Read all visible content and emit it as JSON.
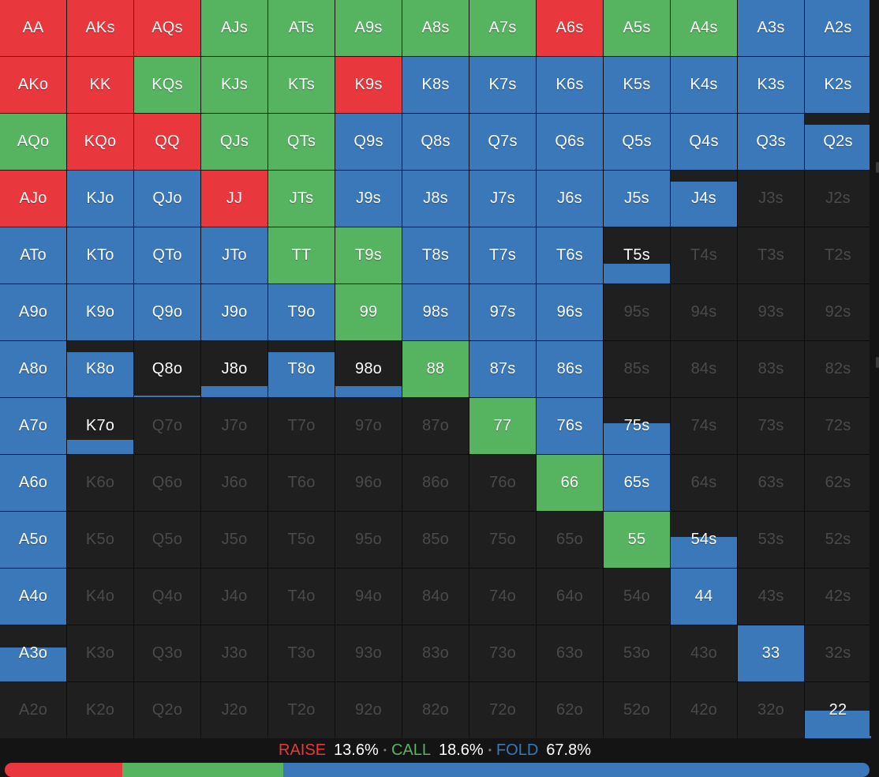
{
  "colors": {
    "raise": "#e8383d",
    "call": "#56b360",
    "fold": "#3a78ba",
    "empty": "#1f1f1f"
  },
  "summary": {
    "raise_label": "RAISE",
    "raise_pct": "13.6%",
    "call_label": "CALL",
    "call_pct": "18.6%",
    "fold_label": "FOLD",
    "fold_pct": "67.8%"
  },
  "bar": {
    "raise": 0.136,
    "call": 0.186,
    "fold": 0.678
  },
  "cells": [
    [
      "AA",
      "r"
    ],
    [
      "AKs",
      "r"
    ],
    [
      "AQs",
      "r"
    ],
    [
      "AJs",
      "c"
    ],
    [
      "ATs",
      "c"
    ],
    [
      "A9s",
      "c"
    ],
    [
      "A8s",
      "c"
    ],
    [
      "A7s",
      "c"
    ],
    [
      "A6s",
      "r"
    ],
    [
      "A5s",
      "c"
    ],
    [
      "A4s",
      "c"
    ],
    [
      "A3s",
      "f"
    ],
    [
      "A2s",
      "f"
    ],
    [
      "AKo",
      "r"
    ],
    [
      "KK",
      "r"
    ],
    [
      "KQs",
      "c"
    ],
    [
      "KJs",
      "c"
    ],
    [
      "KTs",
      "c"
    ],
    [
      "K9s",
      "r"
    ],
    [
      "K8s",
      "f"
    ],
    [
      "K7s",
      "f"
    ],
    [
      "K6s",
      "f"
    ],
    [
      "K5s",
      "f"
    ],
    [
      "K4s",
      "f"
    ],
    [
      "K3s",
      "f"
    ],
    [
      "K2s",
      "f"
    ],
    [
      "AQo",
      "c"
    ],
    [
      "KQo",
      "r"
    ],
    [
      "QQ",
      "r"
    ],
    [
      "QJs",
      "c"
    ],
    [
      "QTs",
      "c"
    ],
    [
      "Q9s",
      "f"
    ],
    [
      "Q8s",
      "f"
    ],
    [
      "Q7s",
      "f"
    ],
    [
      "Q6s",
      "f"
    ],
    [
      "Q5s",
      "f"
    ],
    [
      "Q4s",
      "f"
    ],
    [
      "Q3s",
      "f"
    ],
    [
      "Q2s",
      "f",
      0.8
    ],
    [
      "AJo",
      "r"
    ],
    [
      "KJo",
      "f"
    ],
    [
      "QJo",
      "f"
    ],
    [
      "JJ",
      "r"
    ],
    [
      "JTs",
      "c"
    ],
    [
      "J9s",
      "f"
    ],
    [
      "J8s",
      "f"
    ],
    [
      "J7s",
      "f"
    ],
    [
      "J6s",
      "f"
    ],
    [
      "J5s",
      "f"
    ],
    [
      "J4s",
      "f",
      0.8
    ],
    [
      "J3s",
      ""
    ],
    [
      "J2s",
      ""
    ],
    [
      "ATo",
      "f"
    ],
    [
      "KTo",
      "f"
    ],
    [
      "QTo",
      "f"
    ],
    [
      "JTo",
      "f"
    ],
    [
      "TT",
      "c"
    ],
    [
      "T9s",
      "c"
    ],
    [
      "T8s",
      "f"
    ],
    [
      "T7s",
      "f"
    ],
    [
      "T6s",
      "f"
    ],
    [
      "T5s",
      "f",
      0.35
    ],
    [
      "T4s",
      ""
    ],
    [
      "T3s",
      ""
    ],
    [
      "T2s",
      ""
    ],
    [
      "A9o",
      "f"
    ],
    [
      "K9o",
      "f"
    ],
    [
      "Q9o",
      "f"
    ],
    [
      "J9o",
      "f"
    ],
    [
      "T9o",
      "f"
    ],
    [
      "99",
      "c"
    ],
    [
      "98s",
      "f"
    ],
    [
      "97s",
      "f"
    ],
    [
      "96s",
      "f"
    ],
    [
      "95s",
      ""
    ],
    [
      "94s",
      ""
    ],
    [
      "93s",
      ""
    ],
    [
      "92s",
      ""
    ],
    [
      "A8o",
      "f"
    ],
    [
      "K8o",
      "f",
      0.8
    ],
    [
      "Q8o",
      "f",
      0.03
    ],
    [
      "J8o",
      "f",
      0.2
    ],
    [
      "T8o",
      "f",
      0.8
    ],
    [
      "98o",
      "f",
      0.2
    ],
    [
      "88",
      "c"
    ],
    [
      "87s",
      "f"
    ],
    [
      "86s",
      "f"
    ],
    [
      "85s",
      ""
    ],
    [
      "84s",
      ""
    ],
    [
      "83s",
      ""
    ],
    [
      "82s",
      ""
    ],
    [
      "A7o",
      "f"
    ],
    [
      "K7o",
      "f",
      0.25
    ],
    [
      "Q7o",
      ""
    ],
    [
      "J7o",
      ""
    ],
    [
      "T7o",
      ""
    ],
    [
      "97o",
      ""
    ],
    [
      "87o",
      ""
    ],
    [
      "77",
      "c"
    ],
    [
      "76s",
      "f"
    ],
    [
      "75s",
      "f",
      0.55
    ],
    [
      "74s",
      ""
    ],
    [
      "73s",
      ""
    ],
    [
      "72s",
      ""
    ],
    [
      "A6o",
      "f"
    ],
    [
      "K6o",
      ""
    ],
    [
      "Q6o",
      ""
    ],
    [
      "J6o",
      ""
    ],
    [
      "T6o",
      ""
    ],
    [
      "96o",
      ""
    ],
    [
      "86o",
      ""
    ],
    [
      "76o",
      ""
    ],
    [
      "66",
      "c"
    ],
    [
      "65s",
      "f"
    ],
    [
      "64s",
      ""
    ],
    [
      "63s",
      ""
    ],
    [
      "62s",
      ""
    ],
    [
      "A5o",
      "f"
    ],
    [
      "K5o",
      ""
    ],
    [
      "Q5o",
      ""
    ],
    [
      "J5o",
      ""
    ],
    [
      "T5o",
      ""
    ],
    [
      "95o",
      ""
    ],
    [
      "85o",
      ""
    ],
    [
      "75o",
      ""
    ],
    [
      "65o",
      ""
    ],
    [
      "55",
      "c"
    ],
    [
      "54s",
      "f",
      0.55
    ],
    [
      "53s",
      ""
    ],
    [
      "52s",
      ""
    ],
    [
      "A4o",
      "f"
    ],
    [
      "K4o",
      ""
    ],
    [
      "Q4o",
      ""
    ],
    [
      "J4o",
      ""
    ],
    [
      "T4o",
      ""
    ],
    [
      "94o",
      ""
    ],
    [
      "84o",
      ""
    ],
    [
      "74o",
      ""
    ],
    [
      "64o",
      ""
    ],
    [
      "54o",
      ""
    ],
    [
      "44",
      "f"
    ],
    [
      "43s",
      ""
    ],
    [
      "42s",
      ""
    ],
    [
      "A3o",
      "f",
      0.6
    ],
    [
      "K3o",
      ""
    ],
    [
      "Q3o",
      ""
    ],
    [
      "J3o",
      ""
    ],
    [
      "T3o",
      ""
    ],
    [
      "93o",
      ""
    ],
    [
      "83o",
      ""
    ],
    [
      "73o",
      ""
    ],
    [
      "63o",
      ""
    ],
    [
      "53o",
      ""
    ],
    [
      "43o",
      ""
    ],
    [
      "33",
      "f"
    ],
    [
      "32s",
      ""
    ],
    [
      "A2o",
      ""
    ],
    [
      "K2o",
      ""
    ],
    [
      "Q2o",
      ""
    ],
    [
      "J2o",
      ""
    ],
    [
      "T2o",
      ""
    ],
    [
      "92o",
      ""
    ],
    [
      "82o",
      ""
    ],
    [
      "72o",
      ""
    ],
    [
      "62o",
      ""
    ],
    [
      "52o",
      ""
    ],
    [
      "42o",
      ""
    ],
    [
      "32o",
      ""
    ],
    [
      "22",
      "f",
      0.5
    ]
  ]
}
